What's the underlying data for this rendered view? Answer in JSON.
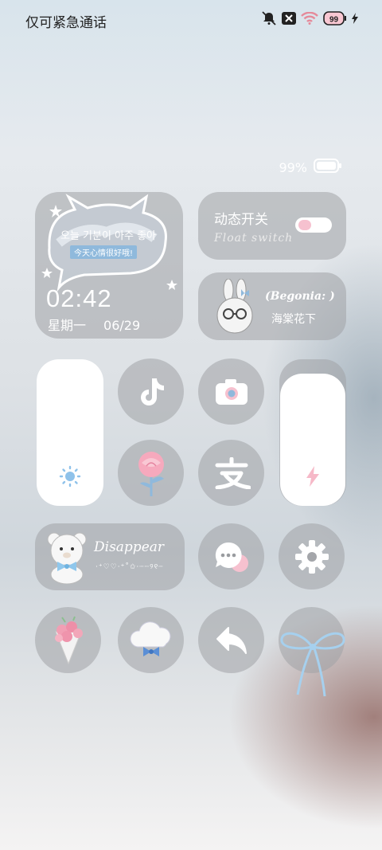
{
  "status_bar": {
    "carrier": "仅可紧急通话",
    "battery_level": "99",
    "icons": [
      "bell-muted-icon",
      "sim-off-icon",
      "wifi-icon",
      "battery-icon",
      "charging-bolt-icon"
    ]
  },
  "battery_widget": {
    "text": "99%",
    "level": 0.99
  },
  "clock_widget": {
    "bubble_text": "오늘 기분이 아주 좋아",
    "bubble_subtext": "今天心情很好哦!",
    "time": "02:42",
    "weekday": "星期一",
    "date": "06/29"
  },
  "float_switch": {
    "title": "动态开关",
    "subtitle": "Float switch",
    "enabled": true
  },
  "begonia": {
    "title": "(Begonia: )",
    "subtitle": "海棠花下"
  },
  "disappear": {
    "title": "Disappear",
    "subtitle": "·⁺♡♡·⁺˚✩·┈┈୨୧┈"
  },
  "apps": {
    "tiktok": "tiktok-icon",
    "camera": "camera-icon",
    "rose": "rose-icon",
    "alipay": "alipay-icon",
    "message": "message-bubble-icon",
    "settings": "gear-icon",
    "bouquet": "rose-bouquet-icon",
    "cloud": "cloud-bow-icon",
    "back": "back-arrow-icon",
    "ribbon": "ribbon-bow-icon"
  },
  "sliders": {
    "brightness": {
      "icon": "sun-icon"
    },
    "power": {
      "icon": "lightning-icon"
    }
  },
  "colors": {
    "accent_pink": "#f6c1cf",
    "accent_blue": "#8fb9dc",
    "tile": "#a0a2a6"
  }
}
